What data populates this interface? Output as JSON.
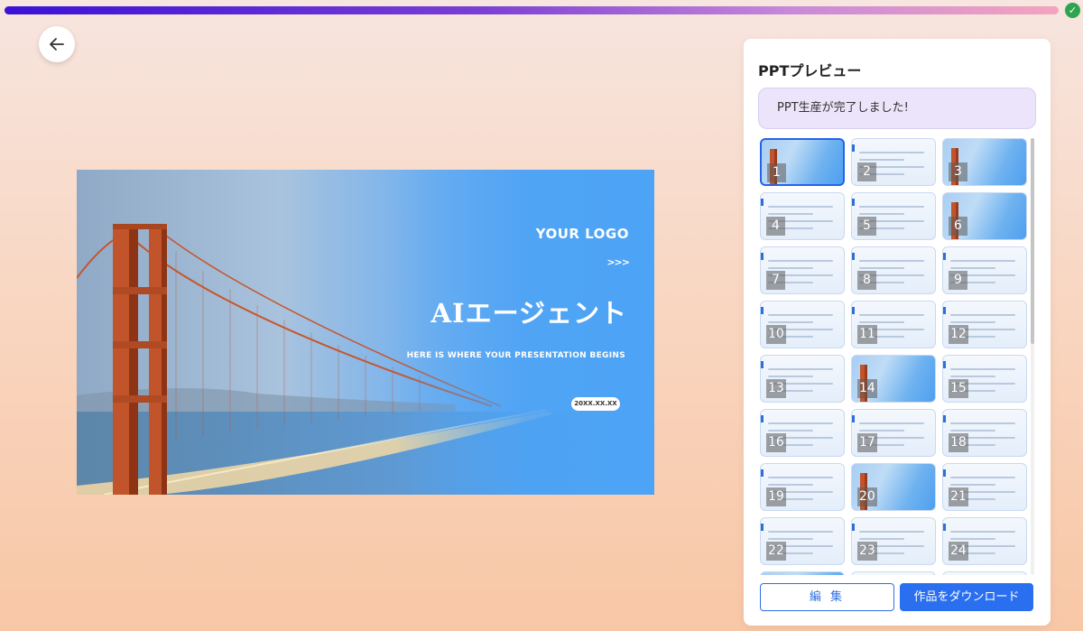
{
  "progress": {
    "value_percent": 100,
    "status_icon": "check-circle-icon",
    "gradient": [
      "#3a12d6",
      "#c88ad8",
      "#f3a4be"
    ]
  },
  "back_button": {
    "icon": "arrow-left-icon"
  },
  "slide": {
    "logo": "YOUR LOGO",
    "arrows": ">>>",
    "title": "AIエージェント",
    "subtitle": "HERE IS WHERE YOUR PRESENTATION BEGINS",
    "date": "20XX.XX.XX",
    "accent": "#4da3f5"
  },
  "panel": {
    "title": "PPTプレビュー",
    "notice": "PPT生産が完了しました!",
    "thumbnails": [
      {
        "n": "1",
        "kind": "photo",
        "selected": true
      },
      {
        "n": "2",
        "kind": "content"
      },
      {
        "n": "3",
        "kind": "photo"
      },
      {
        "n": "4",
        "kind": "content"
      },
      {
        "n": "5",
        "kind": "content"
      },
      {
        "n": "6",
        "kind": "photo"
      },
      {
        "n": "7",
        "kind": "content"
      },
      {
        "n": "8",
        "kind": "content"
      },
      {
        "n": "9",
        "kind": "content"
      },
      {
        "n": "10",
        "kind": "content"
      },
      {
        "n": "11",
        "kind": "content"
      },
      {
        "n": "12",
        "kind": "content"
      },
      {
        "n": "13",
        "kind": "content"
      },
      {
        "n": "14",
        "kind": "photo"
      },
      {
        "n": "15",
        "kind": "content"
      },
      {
        "n": "16",
        "kind": "content"
      },
      {
        "n": "17",
        "kind": "content"
      },
      {
        "n": "18",
        "kind": "content"
      },
      {
        "n": "19",
        "kind": "content"
      },
      {
        "n": "20",
        "kind": "photo"
      },
      {
        "n": "21",
        "kind": "content"
      },
      {
        "n": "22",
        "kind": "content"
      },
      {
        "n": "23",
        "kind": "content"
      },
      {
        "n": "24",
        "kind": "content"
      },
      {
        "n": "",
        "kind": "photo"
      },
      {
        "n": "",
        "kind": "content"
      },
      {
        "n": "",
        "kind": "content"
      }
    ],
    "edit_button": "編 集",
    "download_button": "作品をダウンロード",
    "accent": "#2a6ff0"
  }
}
